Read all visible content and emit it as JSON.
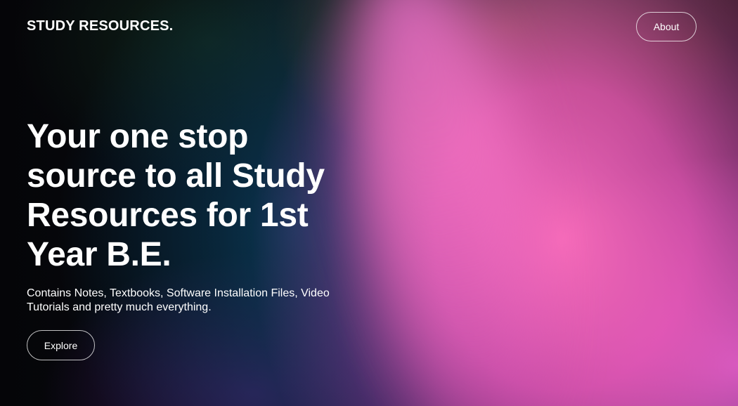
{
  "header": {
    "brand": "STUDY RESOURCES.",
    "about_label": "About"
  },
  "hero": {
    "headline": "Your one stop source to all Study Resources for 1st Year B.E.",
    "subtitle": "Contains Notes, Textbooks, Software Installation Files, Video Tutorials and pretty much everything.",
    "explore_label": "Explore"
  },
  "colors": {
    "text": "#ffffff",
    "background_dark": "#07080c",
    "accent_pink": "#ff6ec0"
  }
}
